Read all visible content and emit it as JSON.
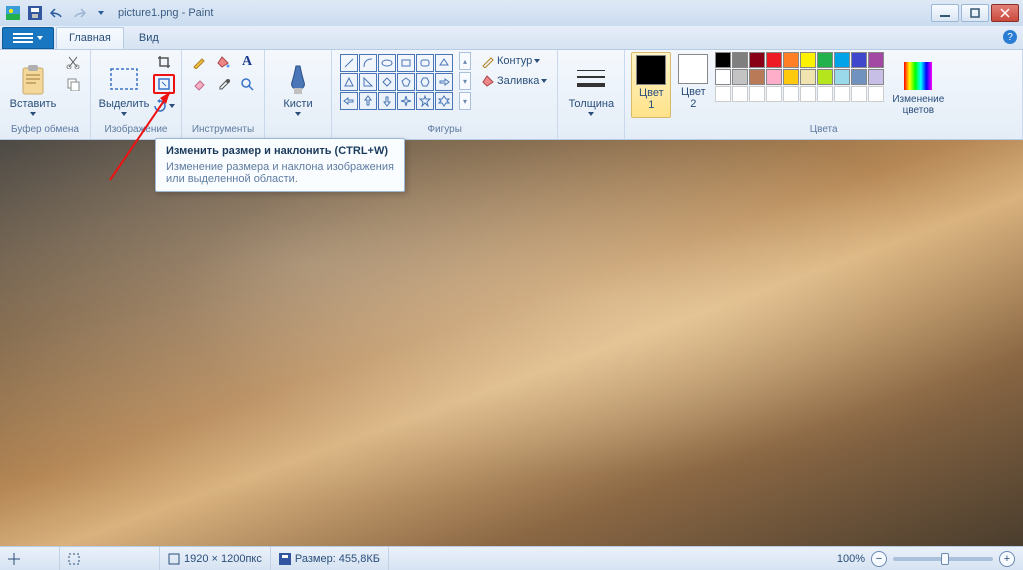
{
  "title": "picture1.png - Paint",
  "tabs": {
    "file": "",
    "home": "Главная",
    "view": "Вид"
  },
  "groups": {
    "clipboard": {
      "label": "Буфер обмена",
      "paste": "Вставить"
    },
    "image": {
      "label": "Изображение",
      "select": "Выделить"
    },
    "tools": {
      "label": "Инструменты"
    },
    "brushes": {
      "label": "",
      "brushes": "Кисти"
    },
    "shapes": {
      "label": "Фигуры",
      "outline": "Контур",
      "fill": "Заливка"
    },
    "size": {
      "label": "",
      "thickness": "Толщина"
    },
    "colors": {
      "label": "Цвета",
      "color1": "Цвет\n1",
      "color2": "Цвет\n2",
      "edit": "Изменение\nцветов"
    }
  },
  "tooltip": {
    "title": "Изменить размер и наклонить (CTRL+W)",
    "body": "Изменение размера и наклона изображения или выделенной области."
  },
  "colors": {
    "c1": "#000000",
    "c2": "#ffffff",
    "palette_row1": [
      "#000000",
      "#7f7f7f",
      "#880015",
      "#ed1c24",
      "#ff7f27",
      "#fff200",
      "#22b14c",
      "#00a2e8",
      "#3f48cc",
      "#a349a4"
    ],
    "palette_row2": [
      "#ffffff",
      "#c3c3c3",
      "#b97a57",
      "#ffaec9",
      "#ffc90e",
      "#efe4b0",
      "#b5e61d",
      "#99d9ea",
      "#7092be",
      "#c8bfe7"
    ],
    "palette_row3": [
      "",
      "",
      "",
      "",
      "",
      "",
      "",
      "",
      "",
      ""
    ]
  },
  "status": {
    "dimensions": "1920 × 1200пкс",
    "size_label": "Размер: 455,8КБ",
    "zoom": "100%"
  }
}
